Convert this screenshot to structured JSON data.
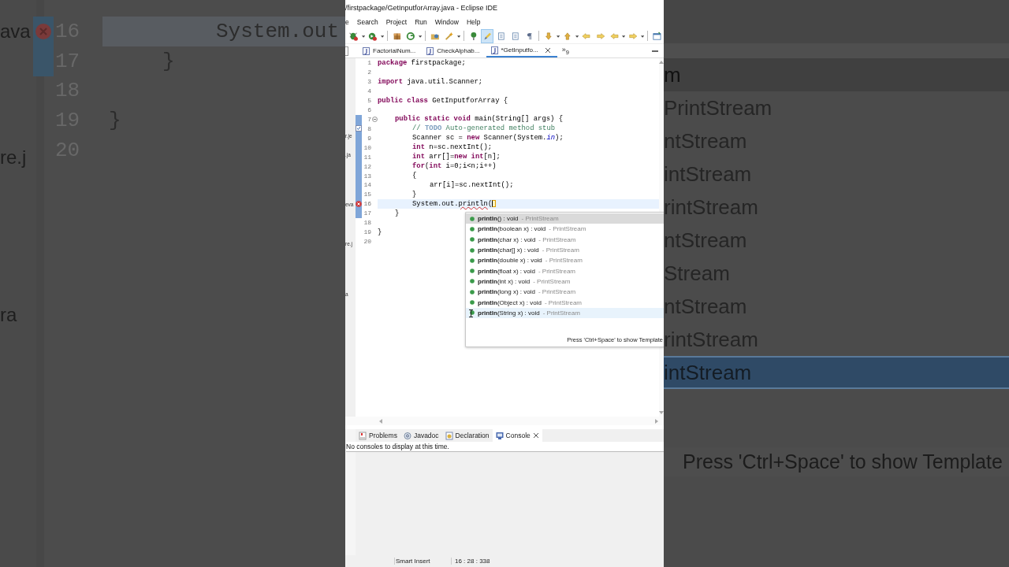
{
  "backdrop_left": {
    "fragments": [
      "ava",
      "re.j",
      "ra"
    ],
    "lines": [
      {
        "number": "16",
        "text": "\t\tSystem.out",
        "error": true,
        "current": true,
        "changed": true
      },
      {
        "number": "17",
        "text": "\t}",
        "error": false,
        "current": false,
        "changed": true
      },
      {
        "number": "18",
        "error": false,
        "current": false,
        "changed": false
      },
      {
        "number": "19",
        "text": "}",
        "error": false,
        "current": false,
        "changed": false
      },
      {
        "number": "20",
        "error": false,
        "current": false,
        "changed": false
      }
    ]
  },
  "window": {
    "title": "/firstpackage/GetInputforArray.java - Eclipse IDE"
  },
  "menu": [
    "e",
    "Search",
    "Project",
    "Run",
    "Window",
    "Help"
  ],
  "toolbar": [
    {
      "kind": "debug",
      "dropdown": true,
      "selected": false
    },
    {
      "kind": "run",
      "dropdown": true,
      "selected": false
    },
    {
      "kind": "separator"
    },
    {
      "kind": "package",
      "dropdown": false,
      "selected": false
    },
    {
      "kind": "refresh",
      "dropdown": true,
      "selected": false
    },
    {
      "kind": "separator"
    },
    {
      "kind": "folder",
      "dropdown": false,
      "selected": false
    },
    {
      "kind": "wand",
      "dropdown": true,
      "selected": false
    },
    {
      "kind": "separator"
    },
    {
      "kind": "pin",
      "dropdown": false,
      "selected": false
    },
    {
      "kind": "highlighter",
      "dropdown": false,
      "selected": true
    },
    {
      "kind": "page",
      "dropdown": false,
      "selected": false
    },
    {
      "kind": "page",
      "dropdown": false,
      "selected": false
    },
    {
      "kind": "pilcrow",
      "dropdown": false,
      "selected": false
    },
    {
      "kind": "separator"
    },
    {
      "kind": "down",
      "dropdown": true,
      "selected": false
    },
    {
      "kind": "up",
      "dropdown": true,
      "selected": false
    },
    {
      "kind": "back",
      "dropdown": false,
      "selected": false
    },
    {
      "kind": "forward",
      "dropdown": false,
      "selected": false
    },
    {
      "kind": "back",
      "dropdown": true,
      "selected": false
    },
    {
      "kind": "forward",
      "dropdown": true,
      "selected": false
    },
    {
      "kind": "separator"
    },
    {
      "kind": "perspective",
      "dropdown": false,
      "selected": false
    }
  ],
  "editor_tabs": [
    {
      "label": "FactorialNum...",
      "selected": false,
      "closable": false
    },
    {
      "label": "CheckAlphab...",
      "selected": false,
      "closable": false
    },
    {
      "label": "*GetInputfo...",
      "selected": true,
      "closable": true
    }
  ],
  "tab_overflow": "»$_{9}$",
  "explorer_fragments": [
    "r.je",
    ".ja",
    "eva",
    "re.j",
    "a"
  ],
  "code_lines": [
    {
      "number": "1",
      "changed": false,
      "error": false,
      "task": false,
      "folding": false,
      "current": false,
      "segments": [
        {
          "kind": "keyword",
          "text": "package"
        },
        {
          "kind": "plain",
          "text": " firstpackage;"
        }
      ]
    },
    {
      "number": "2",
      "changed": false,
      "error": false,
      "task": false,
      "folding": false,
      "current": false
    },
    {
      "number": "3",
      "changed": false,
      "error": false,
      "task": false,
      "folding": false,
      "current": false,
      "segments": [
        {
          "kind": "keyword",
          "text": "import"
        },
        {
          "kind": "plain",
          "text": " java.util.Scanner;"
        }
      ]
    },
    {
      "number": "4",
      "changed": false,
      "error": false,
      "task": false,
      "folding": false,
      "current": false
    },
    {
      "number": "5",
      "changed": false,
      "error": false,
      "task": false,
      "folding": false,
      "current": false,
      "segments": [
        {
          "kind": "keyword",
          "text": "public class"
        },
        {
          "kind": "plain",
          "text": " GetInputforArray {"
        }
      ]
    },
    {
      "number": "6",
      "changed": false,
      "error": false,
      "task": false,
      "folding": false,
      "current": false
    },
    {
      "number": "7",
      "changed": true,
      "error": false,
      "task": false,
      "folding": true,
      "current": false,
      "segments": [
        {
          "kind": "keyword",
          "text": "\tpublic static void"
        },
        {
          "kind": "plain",
          "text": " main(String[] args) {"
        }
      ]
    },
    {
      "number": "8",
      "changed": true,
      "error": false,
      "task": true,
      "folding": false,
      "current": false,
      "segments": [
        {
          "kind": "comment",
          "text": "\t\t// "
        },
        {
          "kind": "todo",
          "text": "TODO"
        },
        {
          "kind": "comment",
          "text": " Auto-generated method stub"
        }
      ]
    },
    {
      "number": "9",
      "changed": true,
      "error": false,
      "task": false,
      "folding": false,
      "current": false,
      "segments": [
        {
          "kind": "plain",
          "text": "\t\tScanner sc = "
        },
        {
          "kind": "keyword",
          "text": "new"
        },
        {
          "kind": "plain",
          "text": " Scanner(System."
        },
        {
          "kind": "field",
          "text": "in"
        },
        {
          "kind": "plain",
          "text": ");"
        }
      ]
    },
    {
      "number": "10",
      "changed": true,
      "error": false,
      "task": false,
      "folding": false,
      "current": false,
      "segments": [
        {
          "kind": "keyword",
          "text": "\t\tint"
        },
        {
          "kind": "plain",
          "text": " n=sc.nextInt();"
        }
      ]
    },
    {
      "number": "11",
      "changed": true,
      "error": false,
      "task": false,
      "folding": false,
      "current": false,
      "segments": [
        {
          "kind": "keyword",
          "text": "\t\tint"
        },
        {
          "kind": "plain",
          "text": " arr[]="
        },
        {
          "kind": "keyword",
          "text": "new int"
        },
        {
          "kind": "plain",
          "text": "[n];"
        }
      ]
    },
    {
      "number": "12",
      "changed": true,
      "error": false,
      "task": false,
      "folding": false,
      "current": false,
      "segments": [
        {
          "kind": "keyword",
          "text": "\t\tfor"
        },
        {
          "kind": "plain",
          "text": "("
        },
        {
          "kind": "keyword",
          "text": "int"
        },
        {
          "kind": "plain",
          "text": " i=0;i<n;i++)"
        }
      ]
    },
    {
      "number": "13",
      "changed": true,
      "error": false,
      "task": false,
      "folding": false,
      "current": false,
      "segments": [
        {
          "kind": "plain",
          "text": "\t\t{"
        }
      ]
    },
    {
      "number": "14",
      "changed": true,
      "error": false,
      "task": false,
      "folding": false,
      "current": false,
      "segments": [
        {
          "kind": "plain",
          "text": "\t\t\tarr[i]=sc.nextInt();"
        }
      ]
    },
    {
      "number": "15",
      "changed": true,
      "error": false,
      "task": false,
      "folding": false,
      "current": false,
      "segments": [
        {
          "kind": "plain",
          "text": "\t\t}"
        }
      ]
    },
    {
      "number": "16",
      "changed": true,
      "error": true,
      "task": false,
      "folding": false,
      "current": true,
      "segments": [
        {
          "kind": "plain",
          "text": "\t\tSystem.out."
        },
        {
          "kind": "error",
          "text": "println"
        },
        {
          "kind": "plain",
          "text": "("
        }
      ]
    },
    {
      "number": "17",
      "changed": true,
      "error": false,
      "task": false,
      "folding": false,
      "current": false,
      "segments": [
        {
          "kind": "plain",
          "text": "\t}"
        }
      ]
    },
    {
      "number": "18",
      "changed": false,
      "error": false,
      "task": false,
      "folding": false,
      "current": false
    },
    {
      "number": "19",
      "changed": false,
      "error": false,
      "task": false,
      "folding": false,
      "current": false,
      "segments": [
        {
          "kind": "plain",
          "text": "}"
        }
      ]
    },
    {
      "number": "20",
      "changed": false,
      "error": false,
      "task": false,
      "folding": false,
      "current": false
    }
  ],
  "completion": {
    "items": [
      {
        "name": "println",
        "params": "() : void",
        "qualifier": "- PrintStream",
        "selected": true,
        "hover": false
      },
      {
        "name": "println",
        "params": "(boolean x) : void",
        "qualifier": "- PrintStream",
        "selected": false,
        "hover": false
      },
      {
        "name": "println",
        "params": "(char x) : void",
        "qualifier": "- PrintStream",
        "selected": false,
        "hover": false
      },
      {
        "name": "println",
        "params": "(char[] x) : void",
        "qualifier": "- PrintStream",
        "selected": false,
        "hover": false
      },
      {
        "name": "println",
        "params": "(double x) : void",
        "qualifier": "- PrintStream",
        "selected": false,
        "hover": false
      },
      {
        "name": "println",
        "params": "(float x) : void",
        "qualifier": "- PrintStream",
        "selected": false,
        "hover": false
      },
      {
        "name": "println",
        "params": "(int x) : void",
        "qualifier": "- PrintStream",
        "selected": false,
        "hover": false
      },
      {
        "name": "println",
        "params": "(long x) : void",
        "qualifier": "- PrintStream",
        "selected": false,
        "hover": false
      },
      {
        "name": "println",
        "params": "(Object x) : void",
        "qualifier": "- PrintStream",
        "selected": false,
        "hover": false
      },
      {
        "name": "println",
        "params": "(String x) : void",
        "qualifier": "- PrintStream",
        "selected": false,
        "hover": true
      }
    ],
    "hint": "Press 'Ctrl+Space' to show Template"
  },
  "panel_tabs": [
    {
      "label": "Problems",
      "kind": "problems",
      "selected": false,
      "closable": false
    },
    {
      "label": "Javadoc",
      "kind": "javadoc",
      "selected": false,
      "closable": false
    },
    {
      "label": "Declaration",
      "kind": "declaration",
      "selected": false,
      "closable": false
    },
    {
      "label": "Console",
      "kind": "console",
      "selected": true,
      "closable": true
    }
  ],
  "console_message": "No consoles to display at this time.",
  "status_bar": [
    "Smart Insert",
    "16 : 28 : 338"
  ],
  "backdrop_right": {
    "rows": [
      {
        "text": "m",
        "selected": true,
        "hover": false
      },
      {
        "text": "PrintStream",
        "selected": false,
        "hover": false
      },
      {
        "text": "ntStream",
        "selected": false,
        "hover": false
      },
      {
        "text": "intStream",
        "selected": false,
        "hover": false
      },
      {
        "text": "rintStream",
        "selected": false,
        "hover": false
      },
      {
        "text": "ntStream",
        "selected": false,
        "hover": false
      },
      {
        "text": "Stream",
        "selected": false,
        "hover": false
      },
      {
        "text": "ntStream",
        "selected": false,
        "hover": false
      },
      {
        "text": "rintStream",
        "selected": false,
        "hover": false
      },
      {
        "text": "intStream",
        "selected": false,
        "hover": true
      }
    ],
    "hint": "Press 'Ctrl+Space' to show Template"
  }
}
